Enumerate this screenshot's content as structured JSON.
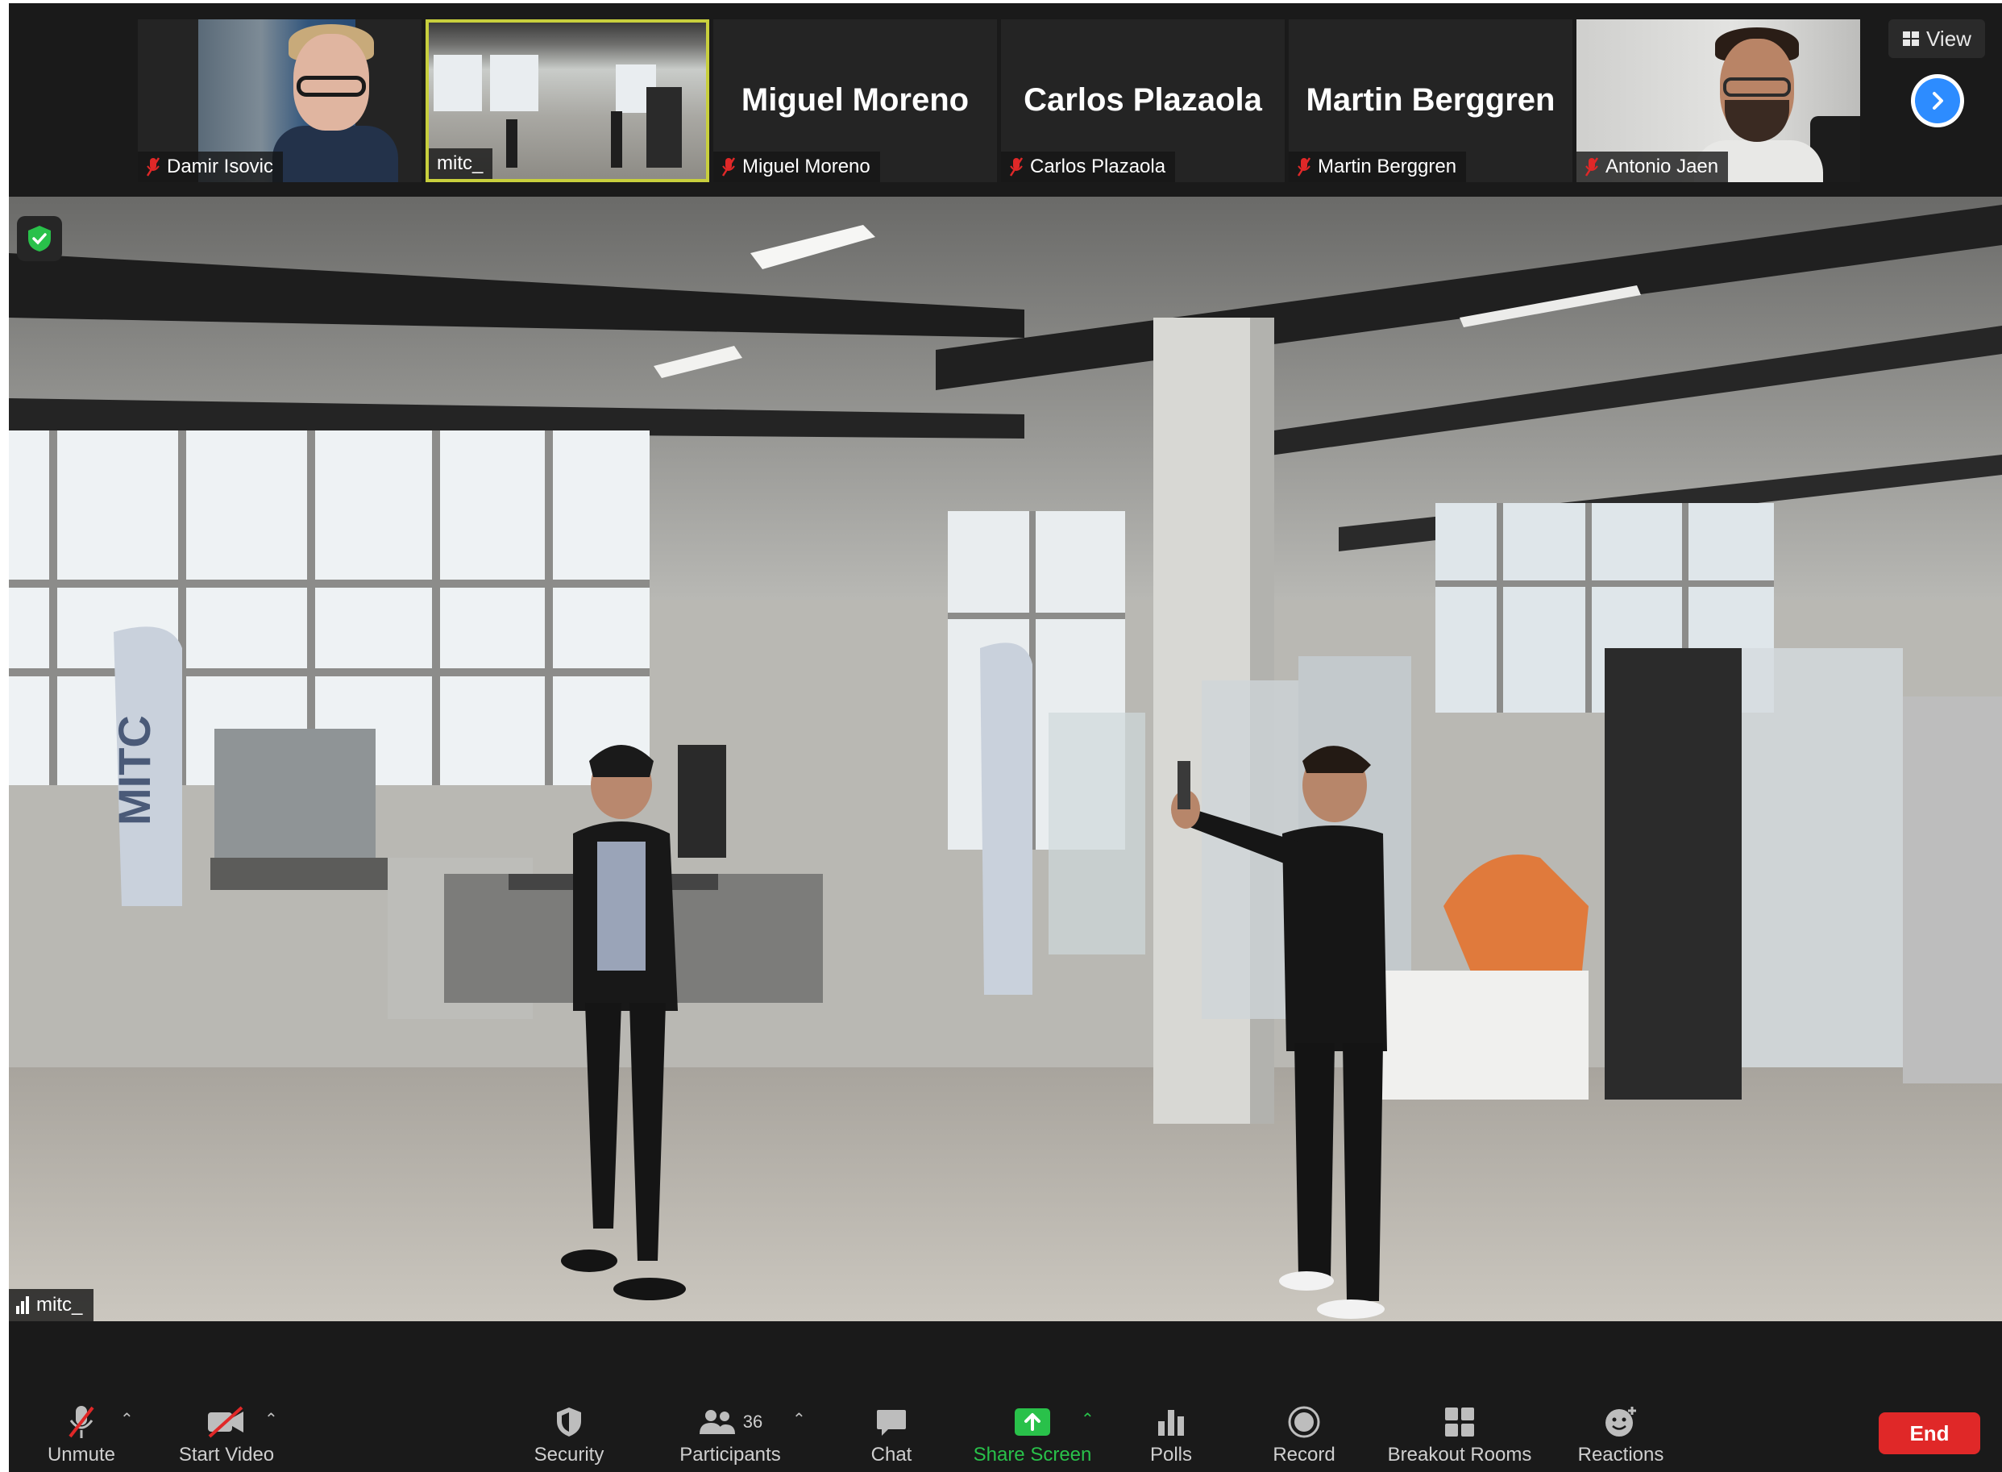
{
  "thumbnails": [
    {
      "name": "Damir Isovic",
      "big_name": "",
      "muted": true,
      "video": "portrait"
    },
    {
      "name": "mitc_",
      "big_name": "",
      "muted": false,
      "video": "lab",
      "active_speaker": true
    },
    {
      "name": "Miguel Moreno",
      "big_name": "Miguel Moreno",
      "muted": true,
      "video": "none"
    },
    {
      "name": "Carlos Plazaola",
      "big_name": "Carlos Plazaola",
      "muted": true,
      "video": "none"
    },
    {
      "name": "Martin Berggren",
      "big_name": "Martin Berggren",
      "muted": true,
      "video": "none"
    },
    {
      "name": "Antonio Jaen",
      "big_name": "",
      "muted": true,
      "video": "portrait"
    }
  ],
  "view_button": {
    "label": "View",
    "icon": "grid-icon"
  },
  "next_page_icon": "chevron-right-icon",
  "main_video": {
    "speaker_label": "mitc_",
    "security_badge_icon": "shield-check-icon",
    "banner_text": "MITC"
  },
  "toolbar": {
    "unmute": "Unmute",
    "start_video": "Start Video",
    "security": "Security",
    "participants": "Participants",
    "participants_count": "36",
    "chat": "Chat",
    "share_screen": "Share Screen",
    "polls": "Polls",
    "record": "Record",
    "breakout_rooms": "Breakout Rooms",
    "reactions": "Reactions",
    "end": "End"
  },
  "colors": {
    "background": "#1a1a1a",
    "active_speaker_border": "#c8cf3d",
    "share_green": "#29c14a",
    "end_red": "#e02828",
    "accent_blue": "#2d8cff",
    "mute_red": "#e02828"
  }
}
